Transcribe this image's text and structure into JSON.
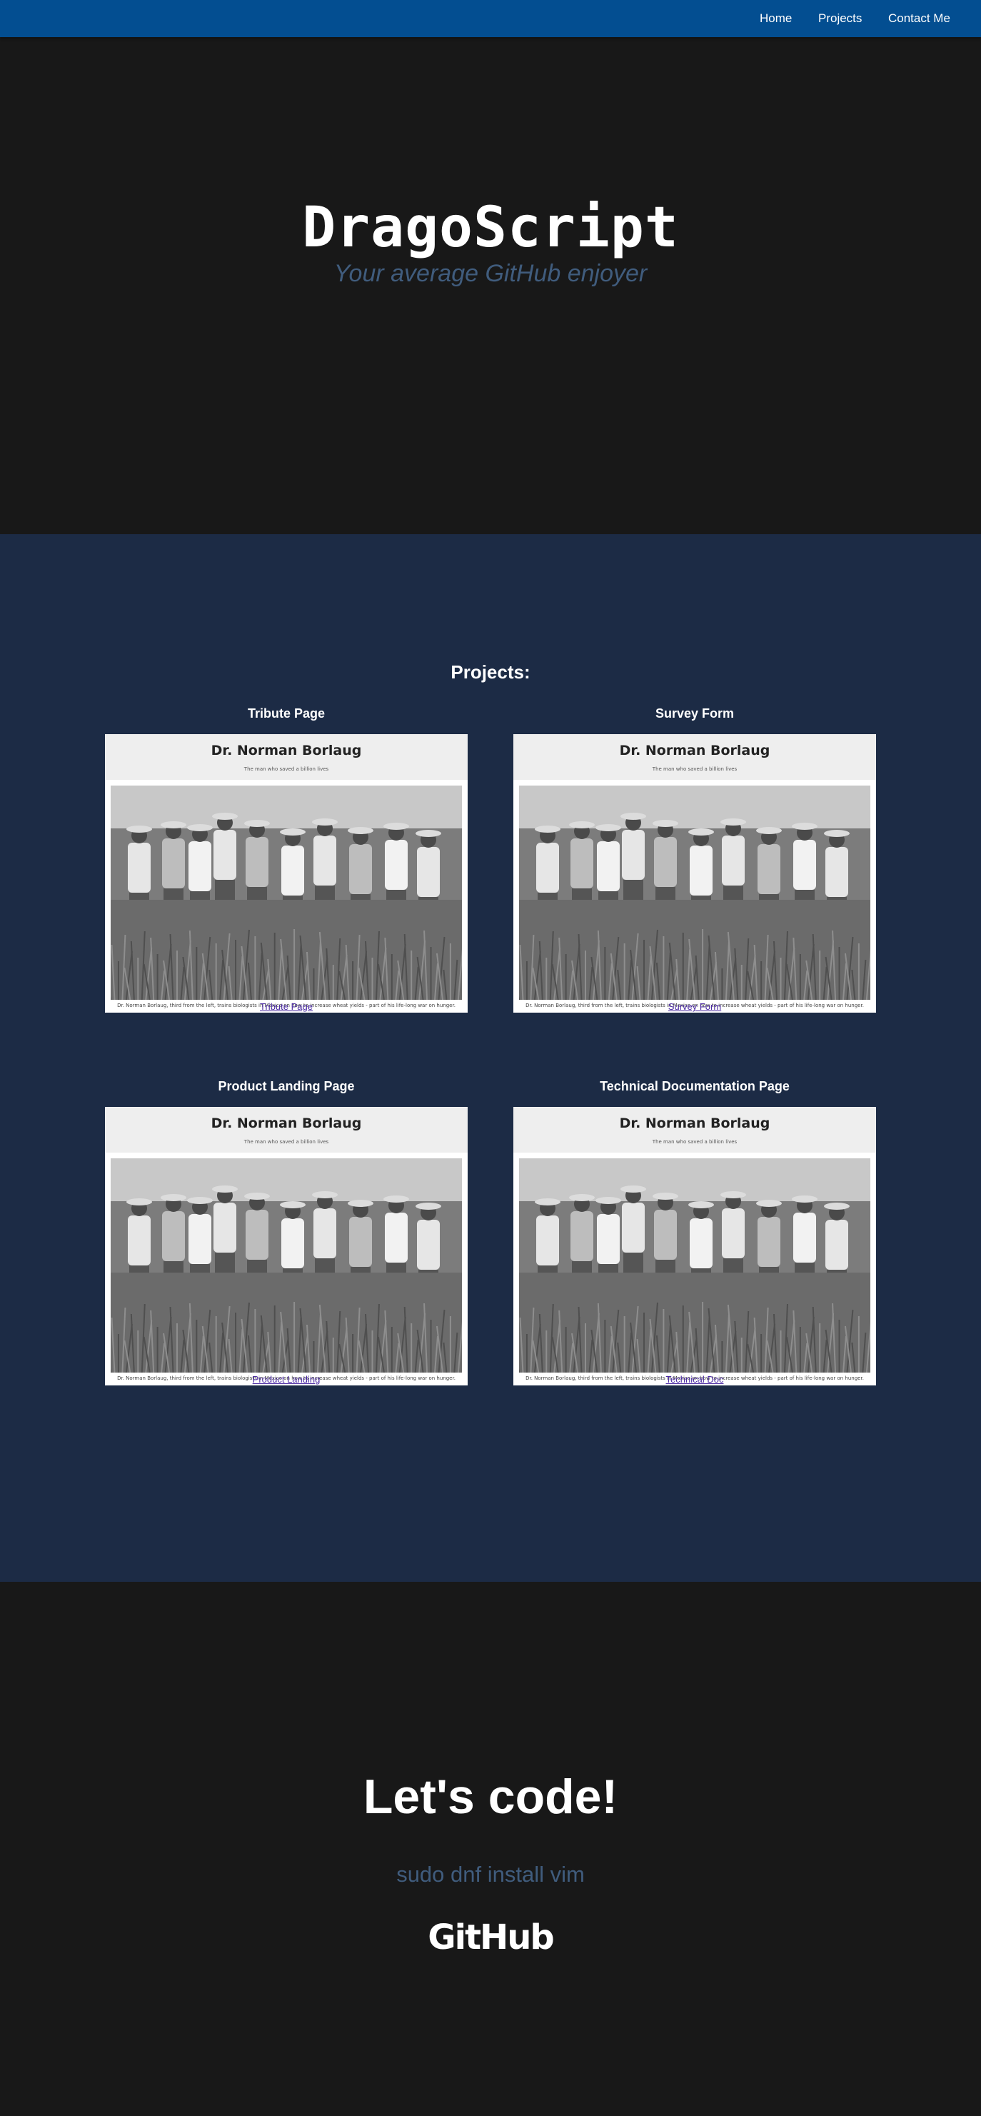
{
  "nav": {
    "items": [
      {
        "label": "Home"
      },
      {
        "label": "Projects"
      },
      {
        "label": "Contact Me"
      }
    ]
  },
  "hero": {
    "title": "DragoScript",
    "subtitle": "Your average GitHub enjoyer"
  },
  "projects": {
    "heading": "Projects:",
    "tiles": [
      {
        "title": "Tribute Page",
        "preview_name": "Dr. Norman Borlaug",
        "preview_tagline": "The man who saved a billion lives",
        "preview_caption": "Dr. Norman Borlaug, third from the left, trains biologists in Mexico on how to increase wheat yields - part of his life-long war on hunger.",
        "link_label": "Tribute Page"
      },
      {
        "title": "Survey Form",
        "preview_name": "Dr. Norman Borlaug",
        "preview_tagline": "The man who saved a billion lives",
        "preview_caption": "Dr. Norman Borlaug, third from the left, trains biologists in Mexico on how to increase wheat yields - part of his life-long war on hunger.",
        "link_label": "Survey Form"
      },
      {
        "title": "Product Landing Page",
        "preview_name": "Dr. Norman Borlaug",
        "preview_tagline": "The man who saved a billion lives",
        "preview_caption": "Dr. Norman Borlaug, third from the left, trains biologists in Mexico on how to increase wheat yields - part of his life-long war on hunger.",
        "link_label": "Product Landing"
      },
      {
        "title": "Technical Documentation Page",
        "preview_name": "Dr. Norman Borlaug",
        "preview_tagline": "The man who saved a billion lives",
        "preview_caption": "Dr. Norman Borlaug, third from the left, trains biologists in Mexico on how to increase wheat yields - part of his life-long war on hunger.",
        "link_label": "Technical Doc"
      }
    ]
  },
  "contact": {
    "title": "Let's code!",
    "command": "sudo dnf install vim",
    "github_label": "GitHub"
  },
  "colors": {
    "nav_bg": "#034e91",
    "dark_bg": "#181818",
    "projects_bg": "#1c2b45",
    "accent_text": "#405c7d",
    "link": "#4b2aa3"
  }
}
